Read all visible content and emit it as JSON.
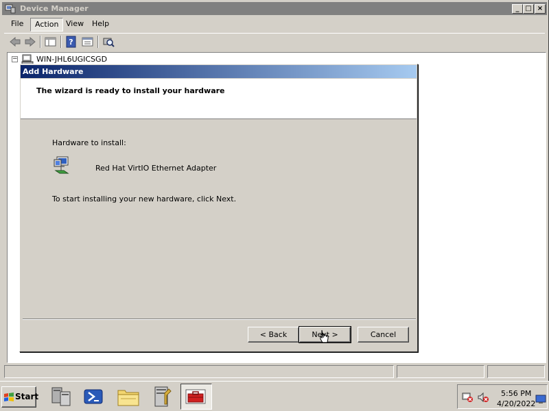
{
  "window": {
    "title": "Device Manager",
    "controls": {
      "minimize": "_",
      "maximize": "□",
      "close": "×"
    }
  },
  "menubar": {
    "items": [
      "File",
      "Action",
      "View",
      "Help"
    ]
  },
  "tree": {
    "root": "WIN-JHL6UGICSGD",
    "expander": "−"
  },
  "dialog": {
    "title": "Add Hardware",
    "heading": "The wizard is ready to install your hardware",
    "hardware_label": "Hardware to install:",
    "hardware_name": "Red Hat VirtIO Ethernet Adapter",
    "instructions": "To start installing your new hardware, click Next.",
    "buttons": {
      "back": "< Back",
      "next": "Next >",
      "cancel": "Cancel"
    }
  },
  "taskbar": {
    "start_label": "Start",
    "tasks": [
      "server-manager-icon",
      "powershell-icon",
      "explorer-icon",
      "admin-tools-icon",
      "device-manager-icon"
    ],
    "clock": {
      "time": "5:56 PM",
      "date": "4/20/2022"
    }
  },
  "colors": {
    "dialog_title_start": "#0a246a",
    "dialog_title_end": "#a6caf0",
    "inactive_title": "#808080",
    "face": "#d4d0c8"
  }
}
